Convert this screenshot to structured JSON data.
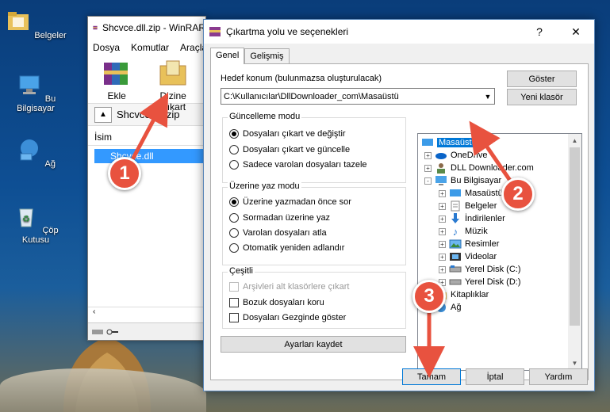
{
  "desktop": {
    "icons": [
      {
        "label": "Belgeler",
        "icon": "folder-documents-icon"
      },
      {
        "label": "Bu Bilgisayar",
        "icon": "computer-icon"
      },
      {
        "label": "Ağ",
        "icon": "network-icon"
      },
      {
        "label": "Çöp Kutusu",
        "icon": "recycle-bin-icon"
      }
    ]
  },
  "winrar": {
    "title": "Shcvce.dll.zip - WinRAR",
    "menu": [
      "Dosya",
      "Komutlar",
      "Araçlar"
    ],
    "toolbar": {
      "add_label": "Ekle",
      "extract_label": "Dizine Çıkart"
    },
    "path": "Shcvce.dll.zip",
    "column_name": "İsim",
    "file": "Shcvce.dll"
  },
  "dialog": {
    "title": "Çıkartma yolu ve seçenekleri",
    "help_btn": "?",
    "close_btn": "✕",
    "tabs": [
      "Genel",
      "Gelişmiş"
    ],
    "dest_label": "Hedef konum (bulunmazsa oluşturulacak)",
    "dest_value": "C:\\Kullanıcılar\\DllDownloader_com\\Masaüstü",
    "show_btn": "Göster",
    "new_folder_btn": "Yeni klasör",
    "update_mode": {
      "title": "Güncelleme modu",
      "options": [
        "Dosyaları çıkart ve değiştir",
        "Dosyaları çıkart ve güncelle",
        "Sadece varolan dosyaları tazele"
      ],
      "selected": 0
    },
    "overwrite_mode": {
      "title": "Üzerine yaz modu",
      "options": [
        "Üzerine yazmadan önce sor",
        "Sormadan üzerine yaz",
        "Varolan dosyaları atla",
        "Otomatik yeniden adlandır"
      ],
      "selected": 0
    },
    "misc": {
      "title": "Çeşitli",
      "options": [
        "Arşivleri alt klasörlere çıkart",
        "Bozuk dosyaları koru",
        "Dosyaları Gezginde göster"
      ]
    },
    "save_settings_btn": "Ayarları kaydet",
    "tree": [
      {
        "label": "Masaüstü",
        "icon": "desktop-icon",
        "level": 0,
        "selected": true
      },
      {
        "label": "OneDrive",
        "icon": "onedrive-icon",
        "level": 1,
        "expander": "+"
      },
      {
        "label": "DLL Downloader.com",
        "icon": "user-icon",
        "level": 1,
        "expander": "+"
      },
      {
        "label": "Bu Bilgisayar",
        "icon": "computer-icon",
        "level": 1,
        "expander": "-"
      },
      {
        "label": "Masaüstü",
        "icon": "desktop-icon",
        "level": 2,
        "expander": "+"
      },
      {
        "label": "Belgeler",
        "icon": "documents-icon",
        "level": 2,
        "expander": "+"
      },
      {
        "label": "İndirilenler",
        "icon": "downloads-icon",
        "level": 2,
        "expander": "+"
      },
      {
        "label": "Müzik",
        "icon": "music-icon",
        "level": 2,
        "expander": "+"
      },
      {
        "label": "Resimler",
        "icon": "pictures-icon",
        "level": 2,
        "expander": "+"
      },
      {
        "label": "Videolar",
        "icon": "videos-icon",
        "level": 2,
        "expander": "+"
      },
      {
        "label": "Yerel Disk (C:)",
        "icon": "disk-icon",
        "level": 2,
        "expander": "+"
      },
      {
        "label": "Yerel Disk (D:)",
        "icon": "disk-icon",
        "level": 2,
        "expander": "+"
      },
      {
        "label": "Kitaplıklar",
        "icon": "libraries-icon",
        "level": 1,
        "expander": "+"
      },
      {
        "label": "Ağ",
        "icon": "network-icon",
        "level": 1,
        "expander": "+"
      }
    ],
    "ok_btn": "Tamam",
    "cancel_btn": "İptal",
    "help_btn_label": "Yardım"
  },
  "markers": [
    "1",
    "2",
    "3"
  ],
  "colors": {
    "marker": "#e8523f",
    "selection": "#0078d7"
  }
}
